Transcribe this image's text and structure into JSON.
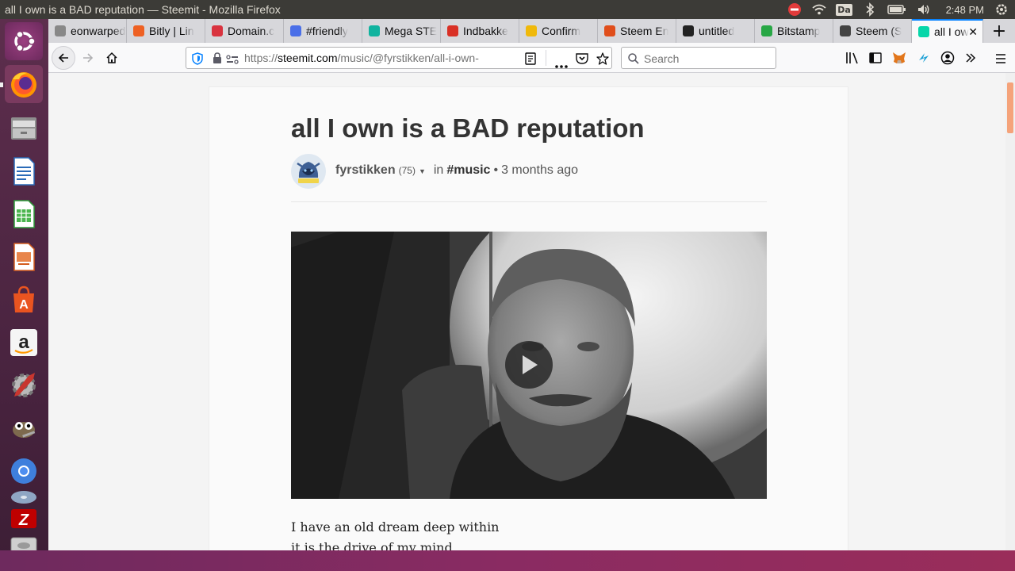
{
  "window": {
    "title": "all I own is a BAD reputation — Steemit - Mozilla Firefox"
  },
  "tray": {
    "keyboard_layout": "Da",
    "clock": "2:48 PM"
  },
  "tabs": [
    {
      "label": "eonwarped.c",
      "favicon": "globe-icon",
      "color": "#888888"
    },
    {
      "label": "Bitly | Lin",
      "favicon": "bitly-icon",
      "color": "#ee6123"
    },
    {
      "label": "Domain.c",
      "favicon": "domain-icon",
      "color": "#d9333f"
    },
    {
      "label": "#friendly",
      "favicon": "discord-icon",
      "color": "#4a6fe8"
    },
    {
      "label": "Mega STE",
      "favicon": "mega-icon",
      "color": "#10b39f"
    },
    {
      "label": "Indbakke",
      "favicon": "gmail-icon",
      "color": "#d93025"
    },
    {
      "label": "Confirm",
      "favicon": "binance-icon",
      "color": "#f0b90b"
    },
    {
      "label": "Steem En",
      "favicon": "steem-icon",
      "color": "#e04e1b"
    },
    {
      "label": "untitled",
      "favicon": "notion-icon",
      "color": "#222222"
    },
    {
      "label": "Bitstamp",
      "favicon": "bitstamp-icon",
      "color": "#28a745"
    },
    {
      "label": "Steem (S",
      "favicon": "coingecko-icon",
      "color": "#444444"
    },
    {
      "label": "all I ow",
      "favicon": "steemit-icon",
      "color": "#06d6a9",
      "active": true
    }
  ],
  "navbar": {
    "url_scheme": "https://",
    "url_host": "steemit.com",
    "url_path": "/music/@fyrstikken/all-i-own-",
    "search_placeholder": "Search"
  },
  "post": {
    "title": "all I own is a BAD reputation",
    "author": "fyrstikken",
    "reputation": "(75)",
    "in_label": "in",
    "category": "#music",
    "separator": "•",
    "age": "3 months ago",
    "avatar_caption": "fyrstikken",
    "body_lines": [
      "I have an old dream deep within",
      "it is the drive of my mind"
    ]
  }
}
